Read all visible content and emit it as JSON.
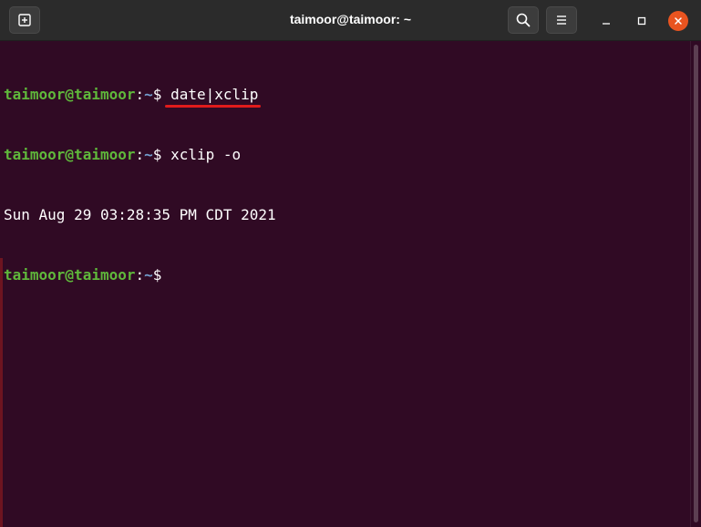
{
  "window": {
    "title": "taimoor@taimoor: ~"
  },
  "colors": {
    "terminal_bg": "#300a24",
    "prompt_user": "#5fb83b",
    "prompt_path": "#729fcf",
    "annotation": "#e01b1b",
    "close_button": "#e95420"
  },
  "icons": {
    "new_tab": "new-tab-icon",
    "search": "search-icon",
    "menu": "hamburger-menu-icon",
    "minimize": "minimize-icon",
    "maximize": "maximize-icon",
    "close": "close-icon"
  },
  "terminal": {
    "prompt_user": "taimoor@taimoor",
    "prompt_colon": ":",
    "prompt_path": "~",
    "prompt_dollar": "$",
    "line1_cmd": "date|xclip",
    "line2_cmd": "xclip -o",
    "line3_output": "Sun Aug 29 03:28:35 PM CDT 2021"
  }
}
